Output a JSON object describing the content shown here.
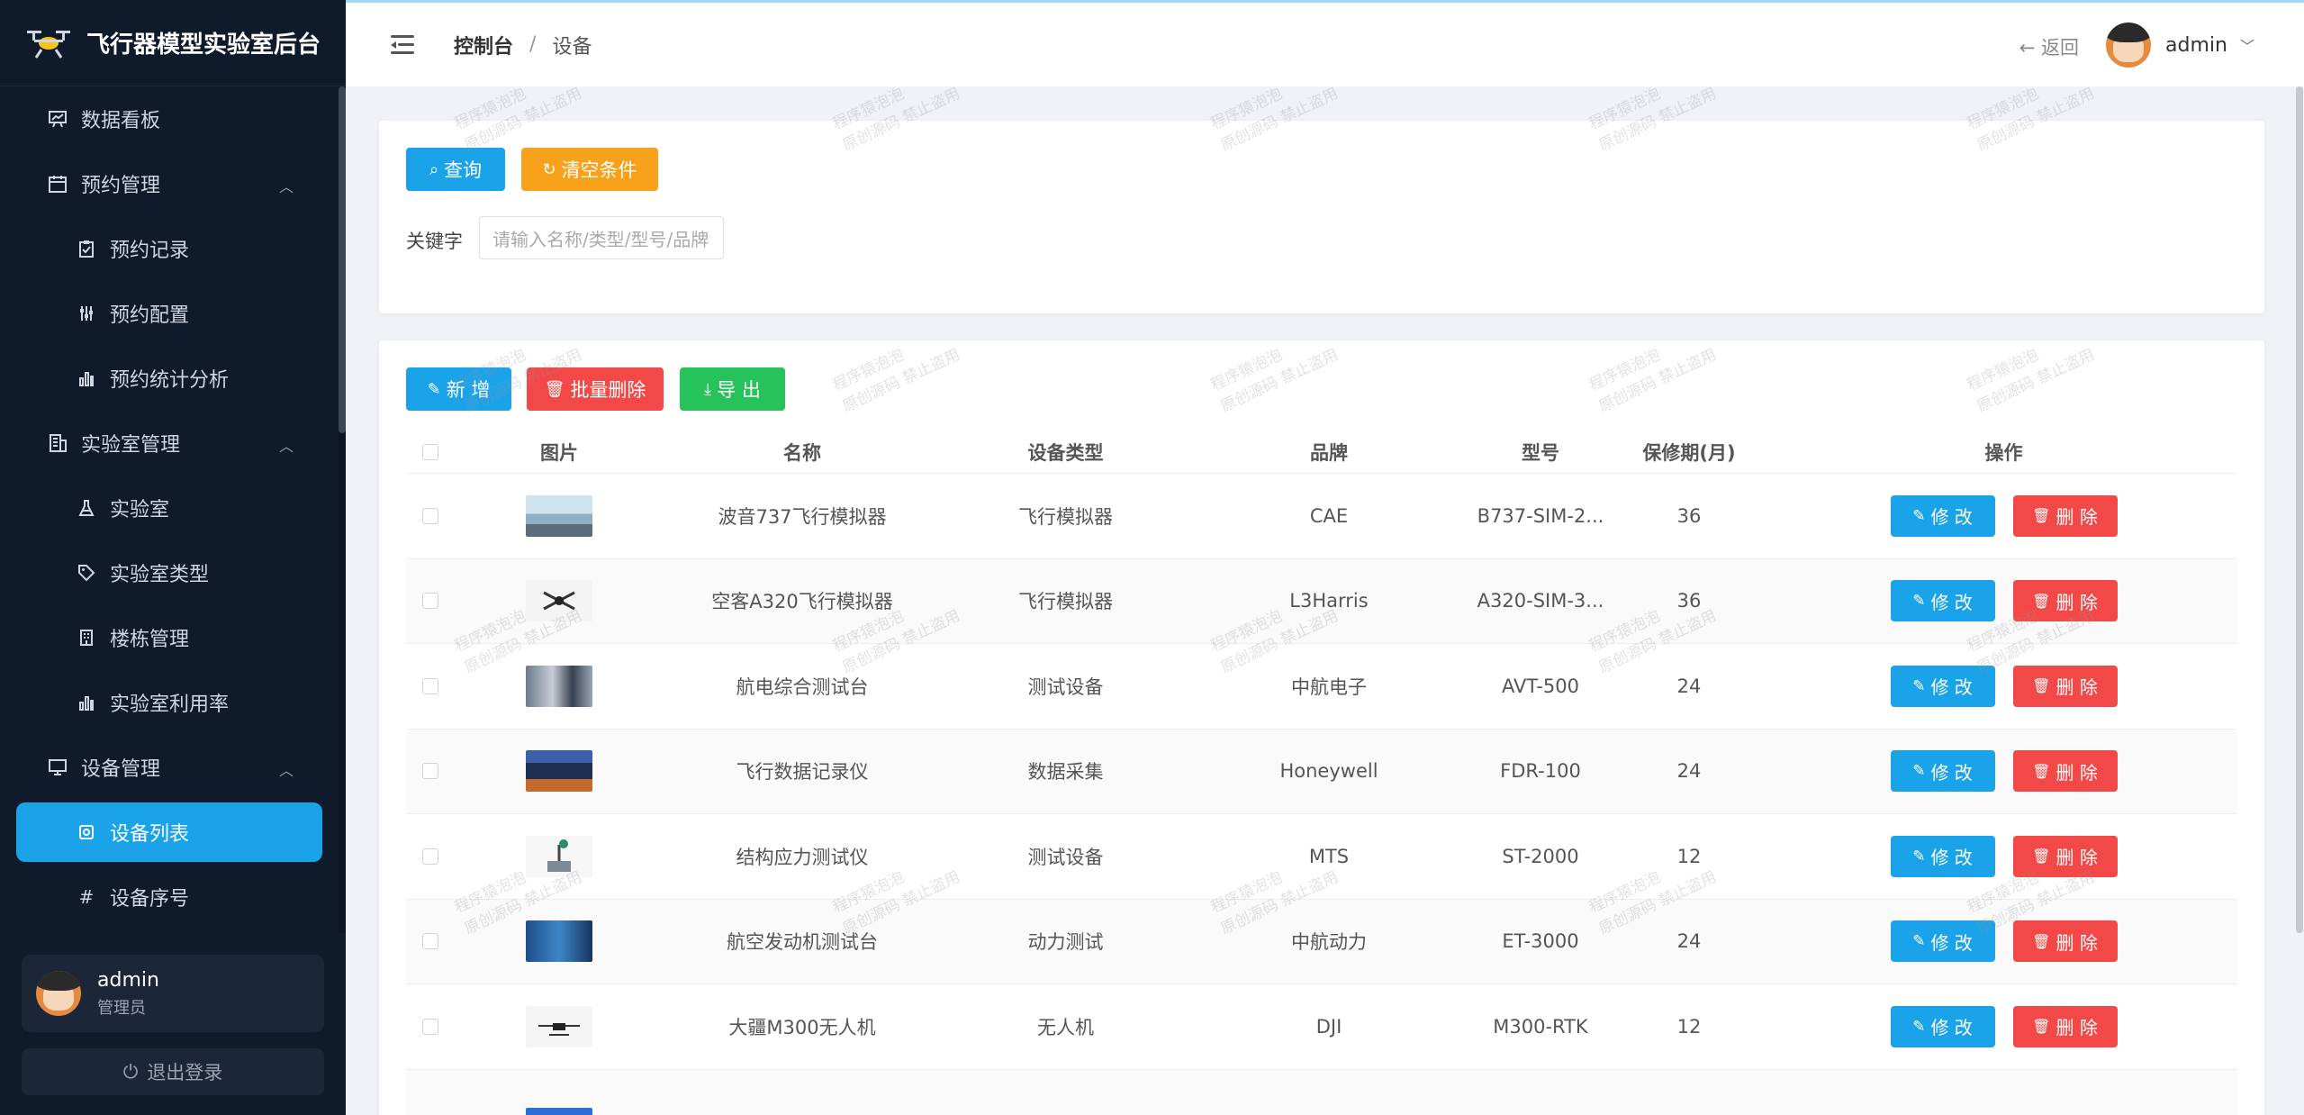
{
  "app": {
    "title": "飞行器模型实验室后台"
  },
  "sidebar": {
    "items": [
      {
        "label": "数据看板",
        "icon": "dashboard-icon",
        "level": "top"
      },
      {
        "label": "预约管理",
        "icon": "calendar-icon",
        "level": "top",
        "expanded": true
      },
      {
        "label": "预约记录",
        "icon": "clipboard-icon",
        "level": "sub"
      },
      {
        "label": "预约配置",
        "icon": "sliders-icon",
        "level": "sub"
      },
      {
        "label": "预约统计分析",
        "icon": "bar-chart-icon",
        "level": "sub"
      },
      {
        "label": "实验室管理",
        "icon": "building-icon",
        "level": "top",
        "expanded": true
      },
      {
        "label": "实验室",
        "icon": "flask-icon",
        "level": "sub"
      },
      {
        "label": "实验室类型",
        "icon": "tag-icon",
        "level": "sub"
      },
      {
        "label": "楼栋管理",
        "icon": "office-icon",
        "level": "sub"
      },
      {
        "label": "实验室利用率",
        "icon": "bar-chart-icon",
        "level": "sub"
      },
      {
        "label": "设备管理",
        "icon": "monitor-icon",
        "level": "top",
        "expanded": true
      },
      {
        "label": "设备列表",
        "icon": "device-icon",
        "level": "sub",
        "active": true
      },
      {
        "label": "设备序号",
        "icon": "hash-icon",
        "level": "sub"
      }
    ],
    "user": {
      "name": "admin",
      "role": "管理员"
    },
    "logout_label": "退出登录"
  },
  "header": {
    "breadcrumb": [
      "控制台",
      "设备"
    ],
    "back_label": "返回",
    "user_name": "admin"
  },
  "search": {
    "query_label": "查询",
    "clear_label": "清空条件",
    "keyword_label": "关键字",
    "keyword_placeholder": "请输入名称/类型/型号/品牌",
    "keyword_value": ""
  },
  "toolbar": {
    "add_label": "新 增",
    "batch_delete_label": "批量删除",
    "export_label": "导 出"
  },
  "table": {
    "columns": [
      "图片",
      "名称",
      "设备类型",
      "品牌",
      "型号",
      "保修期(月)",
      "操作"
    ],
    "edit_label": "修 改",
    "delete_label": "删 除",
    "rows": [
      {
        "name": "波音737飞行模拟器",
        "type": "飞行模拟器",
        "brand": "CAE",
        "model": "B737-SIM-2...",
        "warranty": "36"
      },
      {
        "name": "空客A320飞行模拟器",
        "type": "飞行模拟器",
        "brand": "L3Harris",
        "model": "A320-SIM-3...",
        "warranty": "36"
      },
      {
        "name": "航电综合测试台",
        "type": "测试设备",
        "brand": "中航电子",
        "model": "AVT-500",
        "warranty": "24"
      },
      {
        "name": "飞行数据记录仪",
        "type": "数据采集",
        "brand": "Honeywell",
        "model": "FDR-100",
        "warranty": "24"
      },
      {
        "name": "结构应力测试仪",
        "type": "测试设备",
        "brand": "MTS",
        "model": "ST-2000",
        "warranty": "12"
      },
      {
        "name": "航空发动机测试台",
        "type": "动力测试",
        "brand": "中航动力",
        "model": "ET-3000",
        "warranty": "24"
      },
      {
        "name": "大疆M300无人机",
        "type": "无人机",
        "brand": "DJI",
        "model": "M300-RTK",
        "warranty": "12"
      }
    ]
  },
  "watermark": {
    "line1": "程序猿泡泡",
    "line2": "原创源码 禁止盗用"
  },
  "colors": {
    "primary": "#1ba3ea",
    "danger": "#f24848",
    "warning": "#f7a21a",
    "success": "#27c25a",
    "sidebar_bg": "#0f1a2b"
  }
}
